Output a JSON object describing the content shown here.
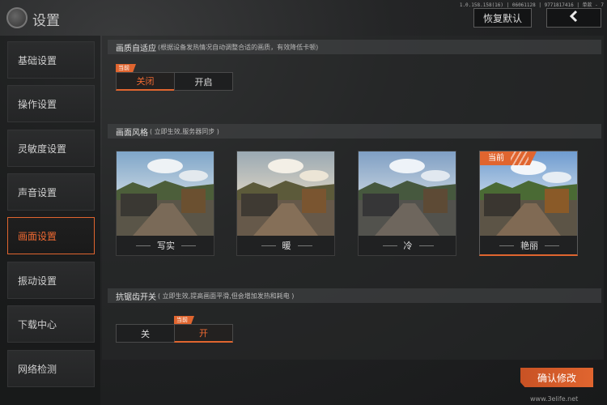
{
  "header": {
    "title": "设置",
    "version": "1.0.158.158(16) | 06061128 | 9771817416 | 单款 - 7",
    "reset_label": "恢复默认",
    "back_icon": "chevron-left-icon"
  },
  "sidebar": {
    "items": [
      {
        "label": "基础设置"
      },
      {
        "label": "操作设置"
      },
      {
        "label": "灵敏度设置"
      },
      {
        "label": "声音设置"
      },
      {
        "label": "画面设置"
      },
      {
        "label": "振动设置"
      },
      {
        "label": "下载中心"
      },
      {
        "label": "网络检测"
      }
    ],
    "active_index": 4
  },
  "sections": {
    "quality": {
      "title": "画质自适应",
      "note": "(根据设备发热情况自动调整合适的画质，有效降低卡顿)",
      "options": [
        "关闭",
        "开启"
      ],
      "selected": "关闭",
      "current_tag": "当前"
    },
    "style": {
      "title": "画面风格",
      "note": "( 立即生效,服务器同步 )",
      "options": [
        "写实",
        "暖",
        "冷",
        "艳丽"
      ],
      "selected": "艳丽",
      "current_tag": "当前"
    },
    "antialias": {
      "title": "抗锯齿开关",
      "note": "( 立即生效,提高画面平滑,但会增加发热和耗电 )",
      "options": [
        "关",
        "开"
      ],
      "selected": "开",
      "current_tag": "当前"
    }
  },
  "footer": {
    "confirm_label": "确认修改",
    "watermark": "www.3elife.net"
  },
  "colors": {
    "accent": "#e0652f",
    "background": "#1b1c1d"
  }
}
